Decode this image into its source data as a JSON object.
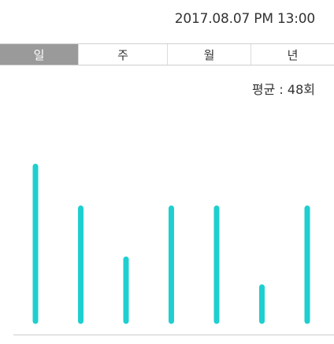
{
  "header": {
    "datetime": "2017.08.07 PM 13:00"
  },
  "tabs": [
    {
      "label": "일",
      "active": true
    },
    {
      "label": "주",
      "active": false
    },
    {
      "label": "월",
      "active": false
    },
    {
      "label": "년",
      "active": false
    }
  ],
  "summary": {
    "label": "평균",
    "separator": " : ",
    "value": "48회"
  },
  "chart_data": {
    "type": "bar",
    "title": "",
    "xlabel": "",
    "ylabel": "",
    "categories": [
      "",
      "",
      "",
      "",
      "",
      "",
      ""
    ],
    "values": [
      100,
      73,
      40,
      73,
      73,
      22,
      73
    ],
    "ylim": [
      0,
      100
    ],
    "bar_color": "#1fcfcf",
    "grid": false
  },
  "colors": {
    "accent": "#1fcfcf",
    "active_tab": "#9a9a9a"
  }
}
